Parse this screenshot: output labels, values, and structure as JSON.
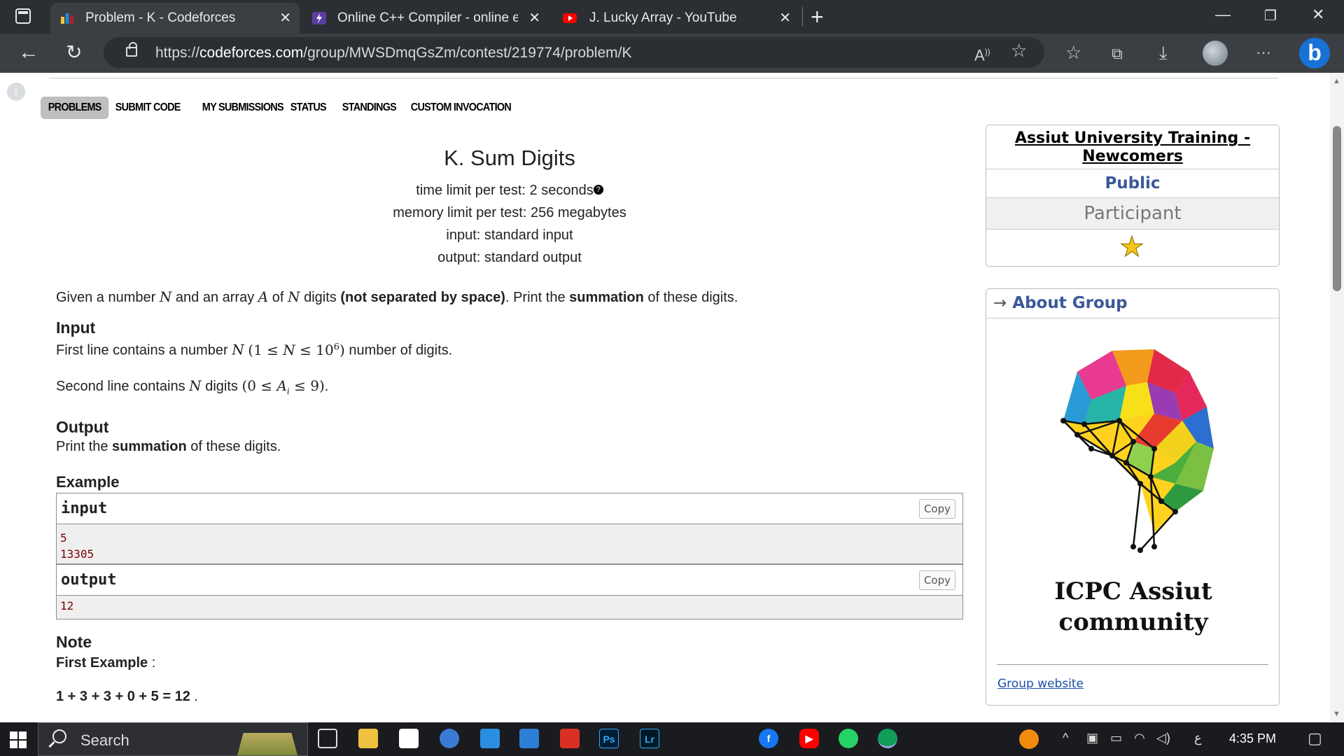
{
  "browser": {
    "tabs": [
      {
        "title": "Problem - K - Codeforces",
        "icon": "codeforces-icon"
      },
      {
        "title": "Online C++ Compiler - online ed",
        "icon": "onlinegdb-icon"
      },
      {
        "title": "J. Lucky Array - YouTube",
        "icon": "youtube-icon"
      }
    ],
    "url_prefix": "https://",
    "url_domain": "codeforces.com",
    "url_path": "/group/MWSDmqGsZm/contest/219774/problem/K"
  },
  "menu": {
    "items": [
      "PROBLEMS",
      "SUBMIT CODE",
      "MY SUBMISSIONS",
      "STATUS",
      "STANDINGS",
      "CUSTOM INVOCATION"
    ]
  },
  "problem": {
    "title": "K. Sum Digits",
    "time_limit": "time limit per test: 2 seconds",
    "memory_limit": "memory limit per test: 256 megabytes",
    "input_type": "input: standard input",
    "output_type": "output: standard output",
    "statement_p1": "Given a number ",
    "statement_p2": " and an array ",
    "statement_p3": " of ",
    "statement_p4": " digits ",
    "statement_bold1": "(not separated by space)",
    "statement_p5": ". Print the ",
    "statement_bold2": "summation",
    "statement_p6": " of these digits.",
    "input_heading": "Input",
    "input_line1_a": "First line contains a number ",
    "input_line1_b": " number of digits.",
    "input_line2_a": "Second line contains ",
    "input_line2_b": " digits ",
    "output_heading": "Output",
    "output_a": "Print the ",
    "output_bold": "summation",
    "output_b": " of these digits.",
    "example_heading": "Example",
    "note_heading": "Note",
    "note_first": "First Example",
    "note_colon": " :",
    "note_calc": "1 + 3 + 3 + 0 + 5 = 12",
    "note_dot": " ."
  },
  "examples": {
    "input_label": "input",
    "input_value": "5\n13305",
    "output_label": "output",
    "output_value": "12",
    "copy_label": "Copy"
  },
  "sidebar": {
    "group_title": "Assiut University Training - Newcomers",
    "visibility": "Public",
    "role": "Participant",
    "about_arrow": "→",
    "about_title": "About Group",
    "logo_line1": "ICPC Assiut",
    "logo_line2": "community",
    "group_website": "Group website"
  },
  "taskbar": {
    "search_placeholder": "Search",
    "time": "4:35 PM",
    "lang": "ع"
  }
}
